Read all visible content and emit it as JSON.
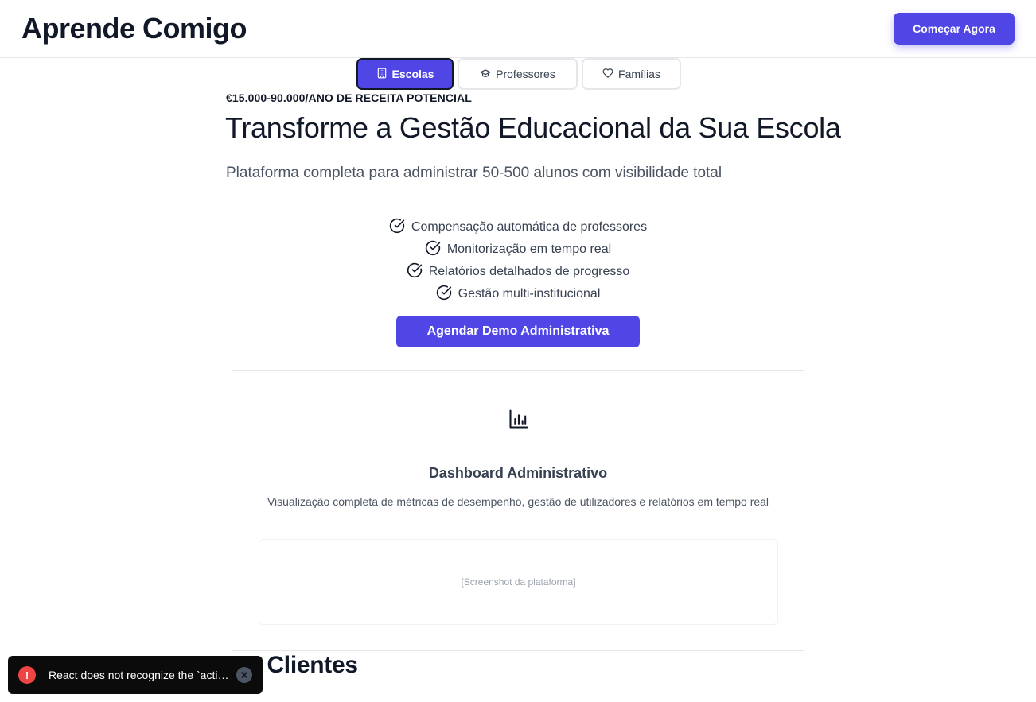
{
  "header": {
    "brand": "Aprende Comigo",
    "cta_label": "Começar Agora"
  },
  "tabs": [
    {
      "label": "Escolas",
      "icon": "building-icon",
      "active": true
    },
    {
      "label": "Professores",
      "icon": "graduation-cap-icon",
      "active": false
    },
    {
      "label": "Famílias",
      "icon": "heart-icon",
      "active": false
    }
  ],
  "hero": {
    "eyebrow": "€15.000-90.000/ANO DE RECEITA POTENCIAL",
    "title": "Transforme a Gestão Educacional da Sua Escola",
    "subtitle": "Plataforma completa para administrar 50-500 alunos com visibilidade total",
    "features": [
      "Compensação automática de professores",
      "Monitorização em tempo real",
      "Relatórios detalhados de progresso",
      "Gestão multi-institucional"
    ],
    "cta_label": "Agendar Demo Administrativa"
  },
  "dashboard_card": {
    "icon": "bar-chart-icon",
    "title": "Dashboard Administrativo",
    "description": "Visualização completa de métricas de desempenho, gestão de utilizadores e relatórios em tempo real",
    "placeholder": "[Screenshot da plataforma]"
  },
  "clients": {
    "heading": "os Clientes"
  },
  "toast": {
    "icon_glyph": "!",
    "message": "React does not recognize the `activeClassName` prop on a DOM element."
  },
  "colors": {
    "primary": "#4f46e5",
    "text": "#111827",
    "muted": "#4b5563",
    "error": "#ef4444"
  }
}
